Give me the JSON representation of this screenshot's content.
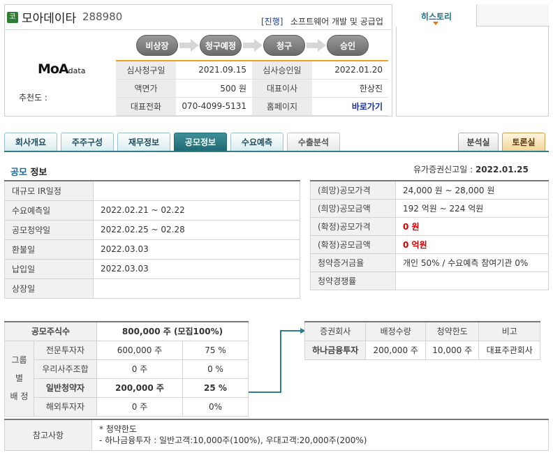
{
  "header": {
    "code_badge": "코",
    "company_name": "모아데이타",
    "stock_code": "288980",
    "status": "[진행]",
    "business": "소프트웨어 개발 및 공급업",
    "steps": [
      "비상장",
      "청구예정",
      "청구",
      "승인"
    ],
    "logo_main": "MoA",
    "logo_sub": "data",
    "recommend_label": "추천도 :"
  },
  "info": {
    "rows": [
      {
        "l1": "심사청구일",
        "v1": "2021.09.15",
        "l2": "심사승인일",
        "v2": "2022.01.20"
      },
      {
        "l1": "액면가",
        "v1": "500 원",
        "l2": "대표이사",
        "v2": "한상진"
      },
      {
        "l1": "대표전화",
        "v1": "070-4099-5131",
        "l2": "홈페이지",
        "v2": "바로가기"
      }
    ]
  },
  "history": {
    "tab_label": "히스토리"
  },
  "tabs": {
    "main": [
      "회사개요",
      "주주구성",
      "재무정보",
      "공모정보",
      "수요예측",
      "수출분석"
    ],
    "analysis": "분석실",
    "discussion": "토론실"
  },
  "section": {
    "title_highlight": "공모",
    "title_rest": " 정보",
    "filing_label": "유가증권신고일 : ",
    "filing_date": "2022.01.25"
  },
  "schedule": [
    {
      "label": "대규모 IR일정",
      "value": ""
    },
    {
      "label": "수요예측일",
      "value": "2022.02.21 ~ 02.22"
    },
    {
      "label": "공모청약일",
      "value": "2022.02.25 ~ 02.28"
    },
    {
      "label": "환불일",
      "value": "2022.03.03"
    },
    {
      "label": "납입일",
      "value": "2022.03.03"
    },
    {
      "label": "상장일",
      "value": ""
    }
  ],
  "pricing": [
    {
      "label": "(희망)공모가격",
      "value": "24,000 원 ~ 28,000 원"
    },
    {
      "label": "(희망)공모금액",
      "value": "192 억원  ~ 224 억원"
    },
    {
      "label": "(확정)공모가격",
      "value": "0 원"
    },
    {
      "label": "(확정)공모금액",
      "value": "0 억원"
    },
    {
      "label": "청약증거금율",
      "value": "개인 50% / 수요예측 참여기관 0%"
    },
    {
      "label": "청약경쟁률",
      "value": ""
    }
  ],
  "allocation": {
    "total_label": "공모주식수",
    "total_value": "800,000 주 (모집100%)",
    "group_label_1": "그룹별",
    "group_label_2": "배 정",
    "rows": [
      {
        "label": "전문투자자",
        "shares": "600,000 주",
        "pct": "75 %"
      },
      {
        "label": "우리사주조합",
        "shares": "0 주",
        "pct": "0 %"
      },
      {
        "label": "일반청약자",
        "shares": "200,000 주",
        "pct": "25 %"
      },
      {
        "label": "해외투자자",
        "shares": "0 주",
        "pct": "0%"
      }
    ]
  },
  "underwriter": {
    "headers": [
      "증권회사",
      "배정수량",
      "청약한도",
      "비고"
    ],
    "rows": [
      {
        "name": "하나금융투자",
        "qty": "200,000 주",
        "limit": "10,000 주",
        "note": "대표주관회사"
      }
    ]
  },
  "notes": {
    "label": "참고사항",
    "line1": "* 청약한도",
    "line2": "- 하나금융투자 : 일반고객:10,000주(100%), 우대고객:20,000주(200%)"
  }
}
